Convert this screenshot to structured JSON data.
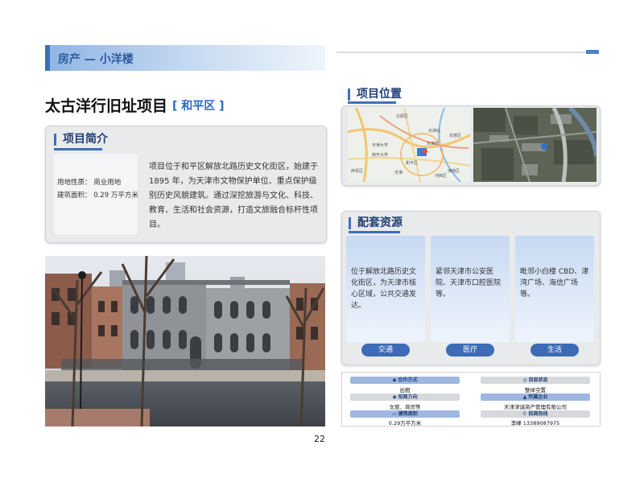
{
  "header": {
    "section": "房产 — 小洋楼"
  },
  "project": {
    "name": "太古洋行旧址项目",
    "district": "[ 和平区 ]"
  },
  "intro": {
    "title": "项目简介",
    "land_use": "用地性质：  商业用地",
    "area": "建筑面积：  0.29 万平方米",
    "description": "项目位于和平区解放北路历史文化街区，始建于 1895 年，为天津市文物保护单位、重点保护级别历史风貌建筑。通过深挖旅游与文化、科技、教育、生活和社会资源，打造文旅融合标杆性项目。"
  },
  "location": {
    "title": "项目位置",
    "map_labels": [
      "北辰区",
      "东丽区",
      "天津站",
      "天津市",
      "和平区",
      "天津",
      "河西区",
      "西青区",
      "津南区",
      "天津大学",
      "南开大学"
    ]
  },
  "resources": {
    "title": "配套资源",
    "items": [
      {
        "text": "位于解放北路历史文化街区，为天津市核心区域，公共交通发达。",
        "tag": "交通"
      },
      {
        "text": "紧邻天津市公安医院、天津市口腔医院等。",
        "tag": "医疗"
      },
      {
        "text": "毗邻小白楼 CBD、津湾广场、海信广场等。",
        "tag": "生活"
      }
    ]
  },
  "info": {
    "cooperation_label": "合作方式",
    "cooperation_value": "出租",
    "status_label": "目前状态",
    "status_value": "整体空置",
    "direction_label": "招商方向",
    "direction_value": "文旅、商贸等",
    "owner_label": "所属企业",
    "owner_value": "天津津诚资产管理有限公司",
    "area_label": "建筑面积",
    "area_value": "0.29万平方米",
    "hotline_label": "招商热线",
    "hotline_value": "李峰 13389087975"
  },
  "page_number": "22",
  "colors": {
    "accent": "#3f6fb8",
    "pill": "#3d6bb5",
    "card": "#e9eaec"
  }
}
